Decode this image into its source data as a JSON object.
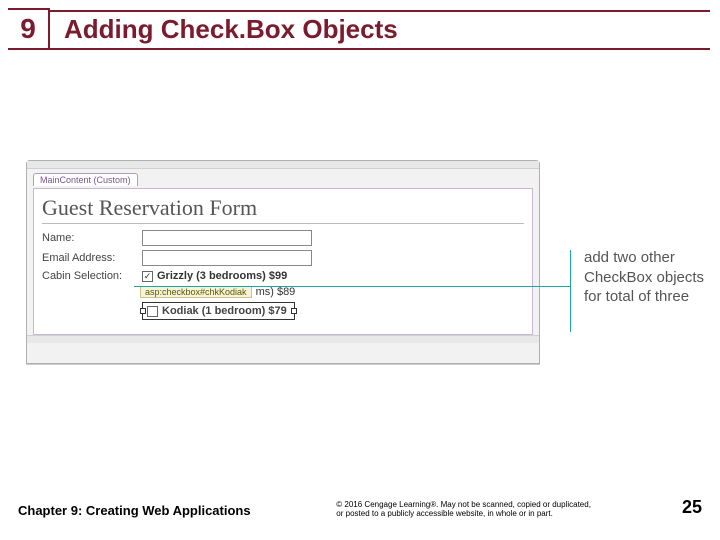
{
  "header": {
    "chapter_number": "9",
    "title": "Adding Check.Box Objects"
  },
  "panel": {
    "tab": "MainContent (Custom)",
    "form_title": "Guest Reservation Form",
    "labels": {
      "name": "Name:",
      "email": "Email Address:",
      "cabin": "Cabin Selection:"
    },
    "cabins": {
      "grizzly": "Grizzly (3 bedrooms) $99",
      "designer_tag_prefix": "asp:checkbox#chkKodiak",
      "designer_tag_suffix": "ms) $89",
      "kodiak": "Kodiak (1 bedroom) $79"
    }
  },
  "annotation": "add two other CheckBox objects for total of three",
  "footer": {
    "chapter": "Chapter 9: Creating Web Applications",
    "copyright": "© 2016 Cengage Learning®. May not be scanned, copied or duplicated, or posted to a publicly accessible website, in whole or in part.",
    "page": "25"
  }
}
